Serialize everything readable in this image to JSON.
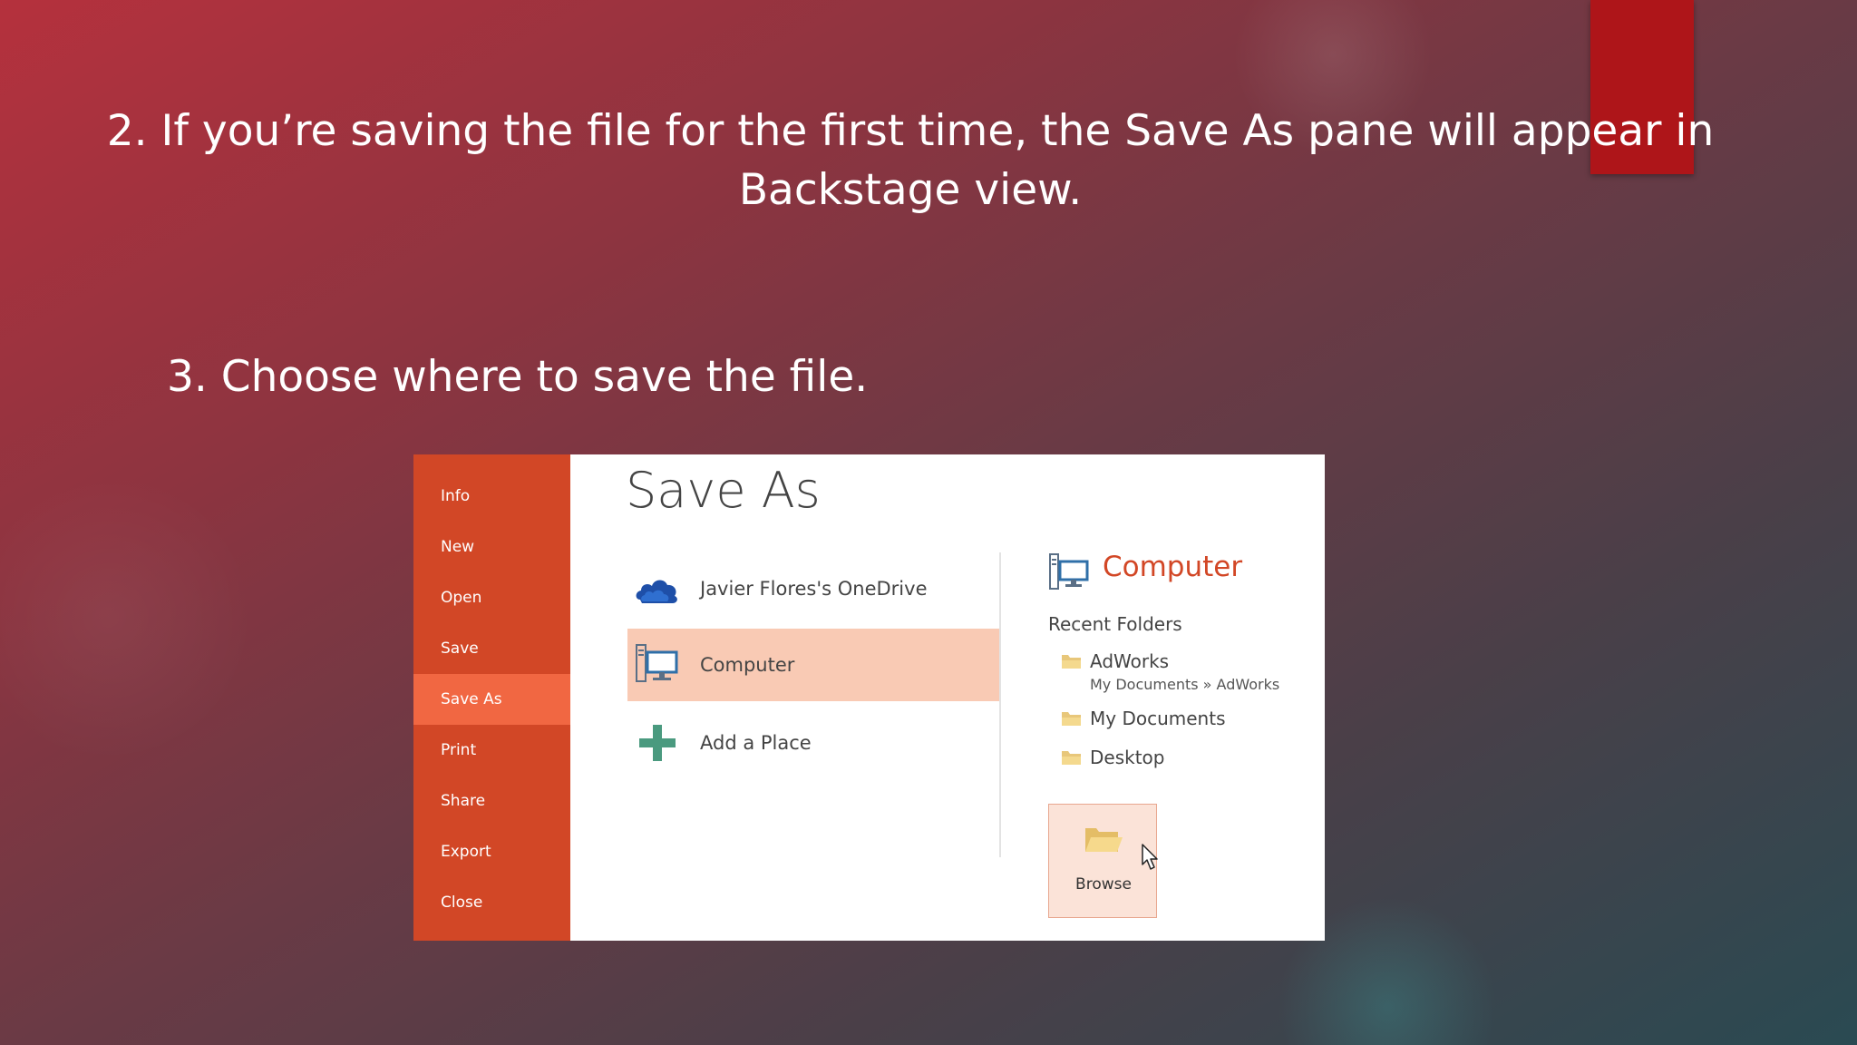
{
  "slide": {
    "step2": "2. If you’re saving the file for the first time, the Save As pane will appear in Backstage view.",
    "step3": "3. Choose where to save the file."
  },
  "backstage": {
    "sidebar": {
      "items": [
        "Info",
        "New",
        "Open",
        "Save",
        "Save As",
        "Print",
        "Share",
        "Export",
        "Close"
      ],
      "active_item": "Save As"
    },
    "title": "Save As",
    "places": [
      {
        "label": "Javier Flores's OneDrive",
        "icon": "onedrive-cloud-icon"
      },
      {
        "label": "Computer",
        "icon": "computer-icon",
        "selected": true
      },
      {
        "label": "Add a Place",
        "icon": "plus-icon"
      }
    ],
    "computer_panel": {
      "title": "Computer",
      "recent_label": "Recent Folders",
      "folders": [
        {
          "name": "AdWorks",
          "path": "My Documents » AdWorks"
        },
        {
          "name": "My Documents"
        },
        {
          "name": "Desktop"
        }
      ],
      "browse_label": "Browse"
    }
  },
  "colors": {
    "sidebar": "#d24726",
    "sidebar_active": "#f16742",
    "selected_place": "#f9cab4",
    "accent_title": "#d24726",
    "accent_block": "#ae1519"
  }
}
